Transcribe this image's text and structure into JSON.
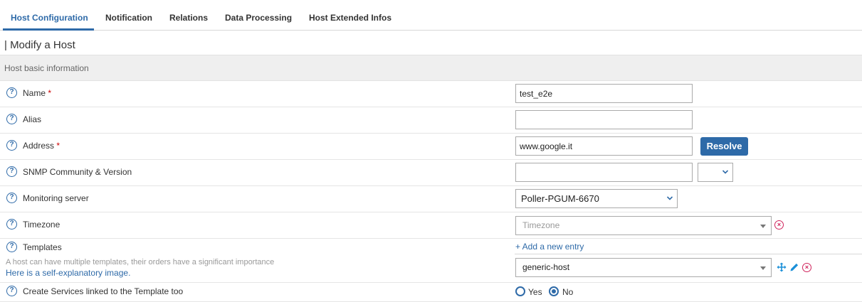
{
  "tabs": [
    {
      "label": "Host Configuration",
      "active": true
    },
    {
      "label": "Notification"
    },
    {
      "label": "Relations"
    },
    {
      "label": "Data Processing"
    },
    {
      "label": "Host Extended Infos"
    }
  ],
  "page": {
    "title": "| Modify a Host",
    "section_title": "Host basic information"
  },
  "fields": {
    "name": {
      "label": "Name",
      "required": "*",
      "value": "test_e2e"
    },
    "alias": {
      "label": "Alias",
      "value": ""
    },
    "address": {
      "label": "Address",
      "required": "*",
      "value": "www.google.it",
      "resolve_label": "Resolve"
    },
    "snmp": {
      "label": "SNMP Community & Version",
      "community_value": "",
      "version_value": ""
    },
    "monitoring_server": {
      "label": "Monitoring server",
      "selected": "Poller-PGUM-6670"
    },
    "timezone": {
      "label": "Timezone",
      "placeholder": "Timezone"
    },
    "templates": {
      "label": "Templates",
      "add_entry": "+ Add a new entry",
      "help_text": "A host can have multiple templates, their orders have a significant importance",
      "help_link": "Here is a self-explanatory image.",
      "selected": "generic-host"
    },
    "create_services": {
      "label": "Create Services linked to the Template too",
      "options": [
        "Yes",
        "No"
      ],
      "selected": "No"
    }
  },
  "colors": {
    "accent": "#2e6aa8",
    "danger": "#d0245c"
  },
  "icons": [
    "help-icon",
    "chevron-down-icon",
    "clear-icon",
    "move-icon",
    "edit-icon"
  ]
}
